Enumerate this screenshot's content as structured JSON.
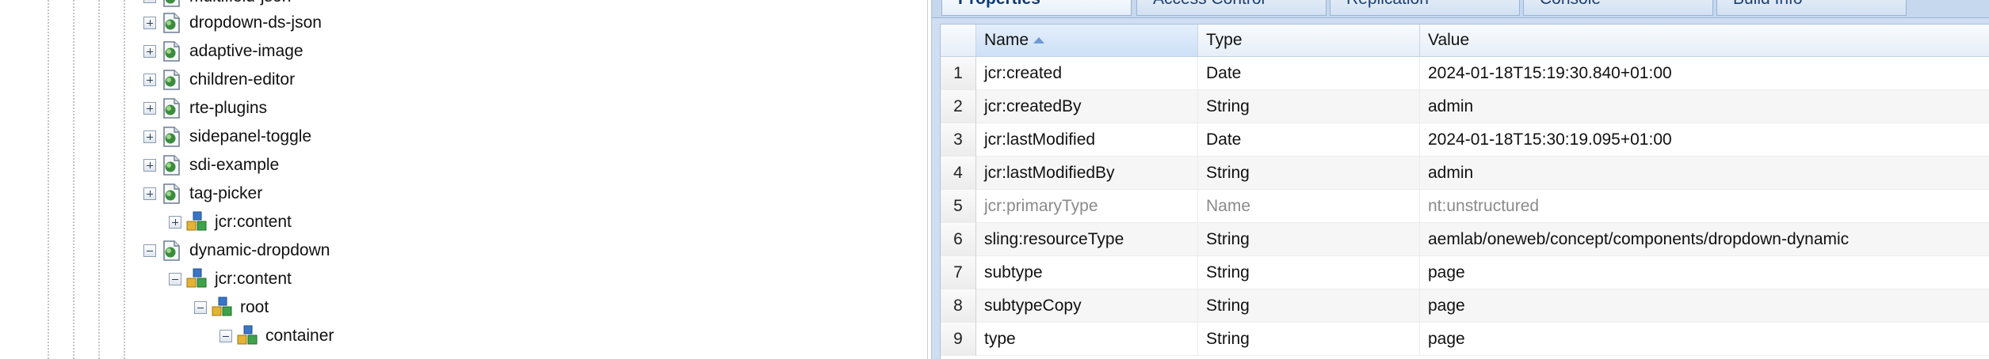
{
  "tree": {
    "clipped_top_label": "multifield-json",
    "items": [
      {
        "label": "dropdown-ds-json",
        "icon": "page-node-icon",
        "expander": "plus"
      },
      {
        "label": "adaptive-image",
        "icon": "page-node-icon",
        "expander": "plus"
      },
      {
        "label": "children-editor",
        "icon": "page-node-icon",
        "expander": "plus"
      },
      {
        "label": "rte-plugins",
        "icon": "page-node-icon",
        "expander": "plus"
      },
      {
        "label": "sidepanel-toggle",
        "icon": "page-node-icon",
        "expander": "plus"
      },
      {
        "label": "sdi-example",
        "icon": "page-node-icon",
        "expander": "plus"
      },
      {
        "label": "tag-picker",
        "icon": "page-node-icon",
        "expander": "plus"
      },
      {
        "label": "jcr:content",
        "icon": "content-node-icon",
        "expander": "plus"
      },
      {
        "label": "dynamic-dropdown",
        "icon": "page-node-icon",
        "expander": "minus"
      },
      {
        "label": "jcr:content",
        "icon": "content-node-icon",
        "expander": "minus"
      },
      {
        "label": "root",
        "icon": "content-node-icon",
        "expander": "minus"
      },
      {
        "label": "container",
        "icon": "content-node-icon",
        "expander": "minus"
      }
    ]
  },
  "tabs": [
    {
      "label": "Properties",
      "active": true
    },
    {
      "label": "Access Control",
      "active": false
    },
    {
      "label": "Replication",
      "active": false
    },
    {
      "label": "Console",
      "active": false
    },
    {
      "label": "Build Info",
      "active": false
    }
  ],
  "grid": {
    "columns": {
      "name": "Name",
      "type": "Type",
      "value": "Value"
    },
    "sort": {
      "column": "Name",
      "direction": "ascending"
    },
    "rows": [
      {
        "num": "1",
        "name": "jcr:created",
        "type": "Date",
        "value": "2024-01-18T15:19:30.840+01:00",
        "muted": false
      },
      {
        "num": "2",
        "name": "jcr:createdBy",
        "type": "String",
        "value": "admin",
        "muted": false
      },
      {
        "num": "3",
        "name": "jcr:lastModified",
        "type": "Date",
        "value": "2024-01-18T15:30:19.095+01:00",
        "muted": false
      },
      {
        "num": "4",
        "name": "jcr:lastModifiedBy",
        "type": "String",
        "value": "admin",
        "muted": false
      },
      {
        "num": "5",
        "name": "jcr:primaryType",
        "type": "Name",
        "value": "nt:unstructured",
        "muted": true
      },
      {
        "num": "6",
        "name": "sling:resourceType",
        "type": "String",
        "value": "aemlab/oneweb/concept/components/dropdown-dynamic",
        "muted": false
      },
      {
        "num": "7",
        "name": "subtype",
        "type": "String",
        "value": "page",
        "muted": false
      },
      {
        "num": "8",
        "name": "subtypeCopy",
        "type": "String",
        "value": "page",
        "muted": false
      },
      {
        "num": "9",
        "name": "type",
        "type": "String",
        "value": "page",
        "muted": false
      }
    ]
  },
  "colors": {
    "tab_active_text": "#0f3a74",
    "grid_border": "#a9bfd9",
    "muted_text": "#8a8a8a"
  }
}
